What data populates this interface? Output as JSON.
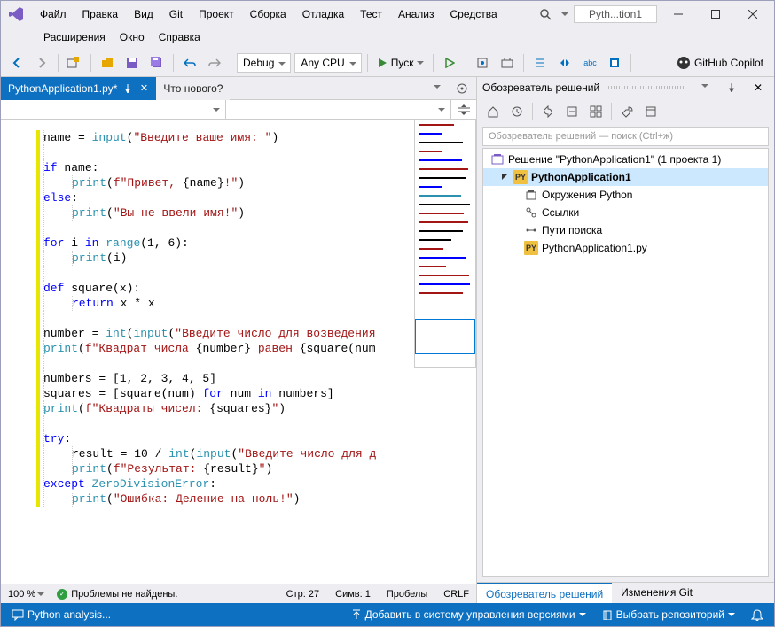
{
  "app": {
    "title": "Pyth...tion1"
  },
  "menu": {
    "row1": [
      "Файл",
      "Правка",
      "Вид",
      "Git",
      "Проект",
      "Сборка",
      "Отладка",
      "Тест",
      "Анализ",
      "Средства"
    ],
    "row2": [
      "Расширения",
      "Окно",
      "Справка"
    ]
  },
  "toolbar": {
    "config": "Debug",
    "platform": "Any CPU",
    "run_label": "Пуск",
    "github": "GitHub Copilot"
  },
  "tabs": {
    "active": "PythonApplication1.py*",
    "inactive": "Что нового?"
  },
  "code_lines": [
    {
      "i": 0,
      "html": "name = <span class='builtin'>input</span>(<span class='str'>\"Введите ваше имя: \"</span>)"
    },
    {
      "i": 0,
      "html": ""
    },
    {
      "i": 0,
      "fold": true,
      "html": "<span class='kw'>if</span> name:"
    },
    {
      "i": 1,
      "html": "<span class='builtin'>print</span>(<span class='str'>f\"Привет, </span>{name}<span class='str'>!\"</span>)"
    },
    {
      "i": 0,
      "fold": true,
      "html": "<span class='kw'>else</span>:"
    },
    {
      "i": 1,
      "html": "<span class='builtin'>print</span>(<span class='str'>\"Вы не ввели имя!\"</span>)"
    },
    {
      "i": 0,
      "html": ""
    },
    {
      "i": 0,
      "fold": true,
      "html": "<span class='kw'>for</span> i <span class='kw'>in</span> <span class='builtin'>range</span>(1, 6):"
    },
    {
      "i": 1,
      "html": "<span class='builtin'>print</span>(i)"
    },
    {
      "i": 0,
      "html": ""
    },
    {
      "i": 0,
      "fold": true,
      "html": "<span class='kw'>def</span> <span class='def-name'>square</span>(x):"
    },
    {
      "i": 1,
      "html": "<span class='kw'>return</span> x * x"
    },
    {
      "i": 0,
      "html": ""
    },
    {
      "i": 0,
      "html": "number = <span class='builtin'>int</span>(<span class='builtin'>input</span>(<span class='str'>\"Введите число для возведения</span>"
    },
    {
      "i": 0,
      "html": "<span class='builtin'>print</span>(<span class='str'>f\"Квадрат числа </span>{number}<span class='str'> равен </span>{square(num"
    },
    {
      "i": 0,
      "html": ""
    },
    {
      "i": 0,
      "html": "numbers = [1, 2, 3, 4, 5]"
    },
    {
      "i": 0,
      "html": "squares = [square(num) <span class='kw'>for</span> num <span class='kw'>in</span> numbers]"
    },
    {
      "i": 0,
      "html": "<span class='builtin'>print</span>(<span class='str'>f\"Квадраты чисел: </span>{squares}<span class='str'>\"</span>)"
    },
    {
      "i": 0,
      "html": ""
    },
    {
      "i": 0,
      "fold": true,
      "html": "<span class='kw'>try</span>:"
    },
    {
      "i": 1,
      "html": "result = 10 / <span class='builtin'>int</span>(<span class='builtin'>input</span>(<span class='str'>\"Введите число для д</span>"
    },
    {
      "i": 1,
      "html": "<span class='builtin'>print</span>(<span class='str'>f\"Результат: </span>{result}<span class='str'>\"</span>)"
    },
    {
      "i": 0,
      "fold": true,
      "html": "<span class='kw'>except</span> <span class='cls'>ZeroDivisionError</span>:"
    },
    {
      "i": 1,
      "html": "<span class='builtin'>print</span>(<span class='str'>\"Ошибка: Деление на ноль!\"</span>)"
    }
  ],
  "editor_status": {
    "zoom": "100 %",
    "problems": "Проблемы не найдены.",
    "line_label": "Стр: 27",
    "col_label": "Симв: 1",
    "indent": "Пробелы",
    "eol": "CRLF"
  },
  "solution_explorer": {
    "title": "Обозреватель решений",
    "search_placeholder": "Обозреватель решений — поиск (Ctrl+ж)",
    "solution": "Решение \"PythonApplication1\"  (1 проекта 1)",
    "project": "PythonApplication1",
    "nodes": [
      "Окружения Python",
      "Ссылки",
      "Пути поиска"
    ],
    "file": "PythonApplication1.py",
    "tabs": {
      "active": "Обозреватель решений",
      "other": "Изменения Git"
    }
  },
  "statusbar": {
    "left": "Python analysis...",
    "add_vcs": "Добавить в систему управления версиями",
    "select_repo": "Выбрать репозиторий"
  }
}
